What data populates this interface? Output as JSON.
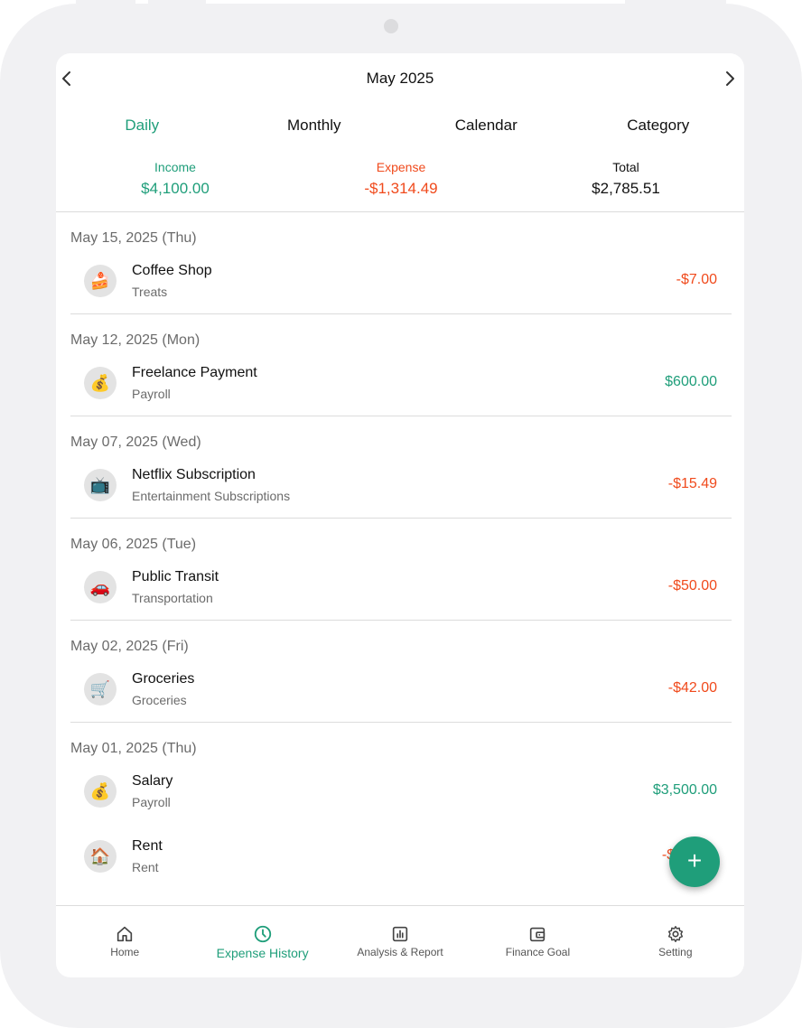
{
  "header": {
    "month_title": "May 2025",
    "prev_icon": "chevron-left-icon",
    "next_icon": "chevron-right-icon"
  },
  "tabs": [
    {
      "label": "Daily",
      "active": true
    },
    {
      "label": "Monthly",
      "active": false
    },
    {
      "label": "Calendar",
      "active": false
    },
    {
      "label": "Category",
      "active": false
    }
  ],
  "summary": {
    "income_label": "Income",
    "income_value": "$4,100.00",
    "expense_label": "Expense",
    "expense_value": "-$1,314.49",
    "total_label": "Total",
    "total_value": "$2,785.51"
  },
  "groups": [
    {
      "date": "May 15, 2025 (Thu)",
      "items": [
        {
          "title": "Coffee Shop",
          "category": "Treats",
          "amount": "-$7.00",
          "type": "expense",
          "icon": "🍰",
          "icon_name": "cake-icon"
        }
      ]
    },
    {
      "date": "May 12, 2025 (Mon)",
      "items": [
        {
          "title": "Freelance Payment",
          "category": "Payroll",
          "amount": "$600.00",
          "type": "income",
          "icon": "💰",
          "icon_name": "money-bag-icon"
        }
      ]
    },
    {
      "date": "May 07, 2025 (Wed)",
      "items": [
        {
          "title": "Netflix Subscription",
          "category": "Entertainment Subscriptions",
          "amount": "-$15.49",
          "type": "expense",
          "icon": "📺",
          "icon_name": "television-icon"
        }
      ]
    },
    {
      "date": "May 06, 2025 (Tue)",
      "items": [
        {
          "title": "Public Transit",
          "category": "Transportation",
          "amount": "-$50.00",
          "type": "expense",
          "icon": "🚗",
          "icon_name": "car-icon"
        }
      ]
    },
    {
      "date": "May 02, 2025 (Fri)",
      "items": [
        {
          "title": "Groceries",
          "category": "Groceries",
          "amount": "-$42.00",
          "type": "expense",
          "icon": "🛒",
          "icon_name": "shopping-cart-icon"
        }
      ]
    },
    {
      "date": "May 01, 2025 (Thu)",
      "items": [
        {
          "title": "Salary",
          "category": "Payroll",
          "amount": "$3,500.00",
          "type": "income",
          "icon": "💰",
          "icon_name": "money-bag-icon"
        },
        {
          "title": "Rent",
          "category": "Rent",
          "amount": "-$1",
          "type": "expense",
          "icon": "🏠",
          "icon_name": "house-icon"
        }
      ]
    }
  ],
  "fab": {
    "label": "+",
    "icon": "plus-icon"
  },
  "nav": [
    {
      "label": "Home",
      "icon": "home-icon",
      "active": false
    },
    {
      "label": "Expense History",
      "icon": "clock-icon",
      "active": true
    },
    {
      "label": "Analysis & Report",
      "icon": "bar-chart-icon",
      "active": false
    },
    {
      "label": "Finance Goal",
      "icon": "wallet-icon",
      "active": false
    },
    {
      "label": "Setting",
      "icon": "gear-icon",
      "active": false
    }
  ],
  "colors": {
    "accent": "#1f9e7a",
    "expense": "#f04a1c",
    "frame": "#f1f1f3"
  }
}
